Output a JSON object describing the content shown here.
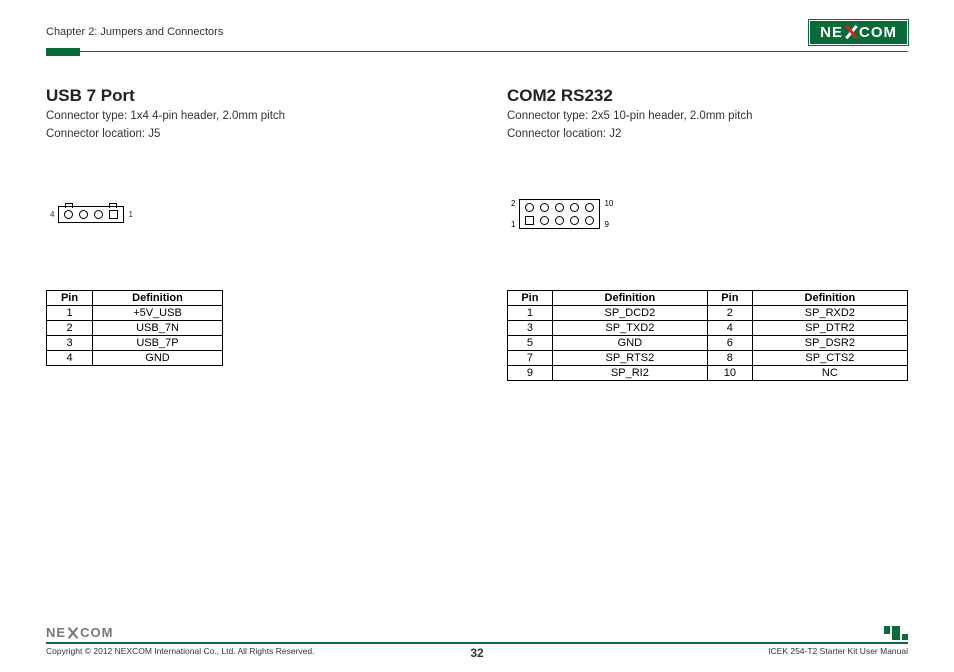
{
  "chapter": "Chapter 2: Jumpers and Connectors",
  "brand": {
    "pre": "NE",
    "post": "COM"
  },
  "left": {
    "title": "USB 7 Port",
    "line1": "Connector type: 1x4 4-pin header, 2.0mm pitch",
    "line2": "Connector location: J5",
    "pin_left": "4",
    "pin_right": "1",
    "headers": {
      "pin": "Pin",
      "def": "Definition"
    },
    "rows": [
      {
        "pin": "1",
        "def": "+5V_USB"
      },
      {
        "pin": "2",
        "def": "USB_7N"
      },
      {
        "pin": "3",
        "def": "USB_7P"
      },
      {
        "pin": "4",
        "def": "GND"
      }
    ]
  },
  "right": {
    "title": "COM2 RS232",
    "line1": "Connector type: 2x5 10-pin header, 2.0mm pitch",
    "line2": "Connector location: J2",
    "top_left": "2",
    "top_right": "10",
    "bot_left": "1",
    "bot_right": "9",
    "headers": {
      "pin": "Pin",
      "def": "Definition"
    },
    "rows": [
      {
        "p1": "1",
        "d1": "SP_DCD2",
        "p2": "2",
        "d2": "SP_RXD2"
      },
      {
        "p1": "3",
        "d1": "SP_TXD2",
        "p2": "4",
        "d2": "SP_DTR2"
      },
      {
        "p1": "5",
        "d1": "GND",
        "p2": "6",
        "d2": "SP_DSR2"
      },
      {
        "p1": "7",
        "d1": "SP_RTS2",
        "p2": "8",
        "d2": "SP_CTS2"
      },
      {
        "p1": "9",
        "d1": "SP_RI2",
        "p2": "10",
        "d2": "NC"
      }
    ]
  },
  "footer": {
    "copyright": "Copyright © 2012 NEXCOM International Co., Ltd. All Rights Reserved.",
    "page": "32",
    "manual": "ICEK 254-T2 Starter Kit User Manual"
  }
}
